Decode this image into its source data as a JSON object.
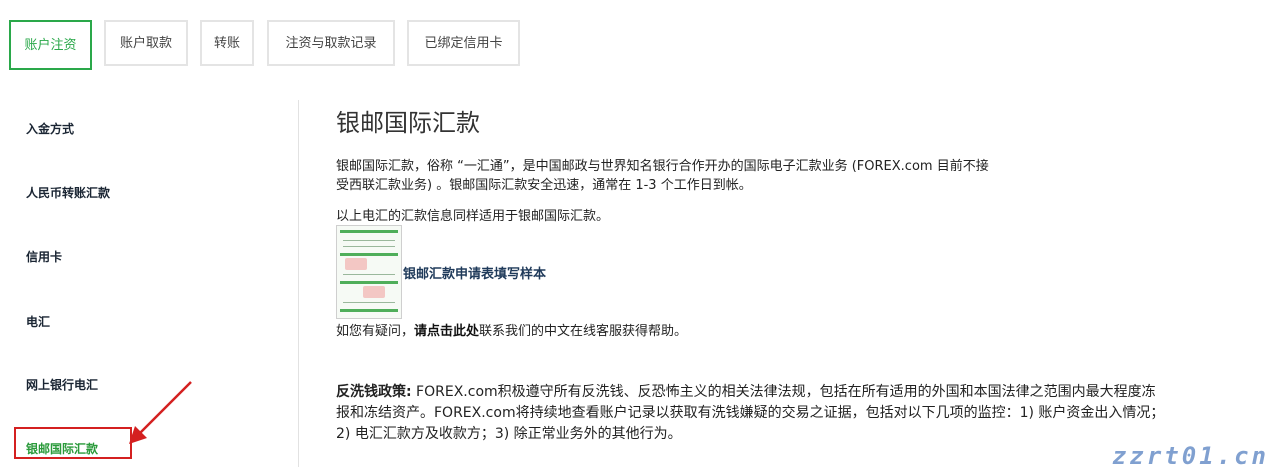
{
  "tabs": [
    {
      "label": "账户注资",
      "active": true
    },
    {
      "label": "账户取款",
      "active": false
    },
    {
      "label": "转账",
      "active": false
    },
    {
      "label": "注资与取款记录",
      "active": false
    },
    {
      "label": "已绑定信用卡",
      "active": false
    }
  ],
  "sidebar": {
    "items": [
      {
        "label": "入金方式"
      },
      {
        "label": "人民币转账汇款"
      },
      {
        "label": "信用卡"
      },
      {
        "label": "电汇"
      },
      {
        "label": "网上银行电汇"
      },
      {
        "label": "银邮国际汇款",
        "active": true
      }
    ]
  },
  "main": {
    "title": "银邮国际汇款",
    "para1_line1": "银邮国际汇款，俗称 “一汇通”，是中国邮政与世界知名银行合作开办的国际电子汇款业务 (FOREX.com 目前不接",
    "para1_line2": "受西联汇款业务) 。银邮国际汇款安全迅速，通常在 1-3 个工作日到帐。",
    "para2": "以上电汇的汇款信息同样适用于银邮国际汇款。",
    "form_link": "银邮汇款申请表填写样本",
    "para3_prefix": "如您有疑问，",
    "para3_link": "请点击此处",
    "para3_suffix": "联系我们的中文在线客服获得帮助。",
    "policy_lead": "反洗钱政策:",
    "policy_line1": " FOREX.com积极遵守所有反洗钱、反恐怖主义的相关法律法规，包括在所有适用的外国和本国法律之范围内最大程度冻",
    "policy_line2": "报和冻结资产。FOREX.com将持续地查看账户记录以获取有洗钱嫌疑的交易之证据，包括对以下几项的监控：1) 账户资金出入情况；",
    "policy_line3": "2) 电汇汇款方及收款方；3) 除正常业务外的其他行为。"
  },
  "watermark": "zzrt01.cn",
  "colors": {
    "accent_green": "#2aa84a",
    "annotation_red": "#d42020",
    "link_navy": "#1f3a5a"
  }
}
